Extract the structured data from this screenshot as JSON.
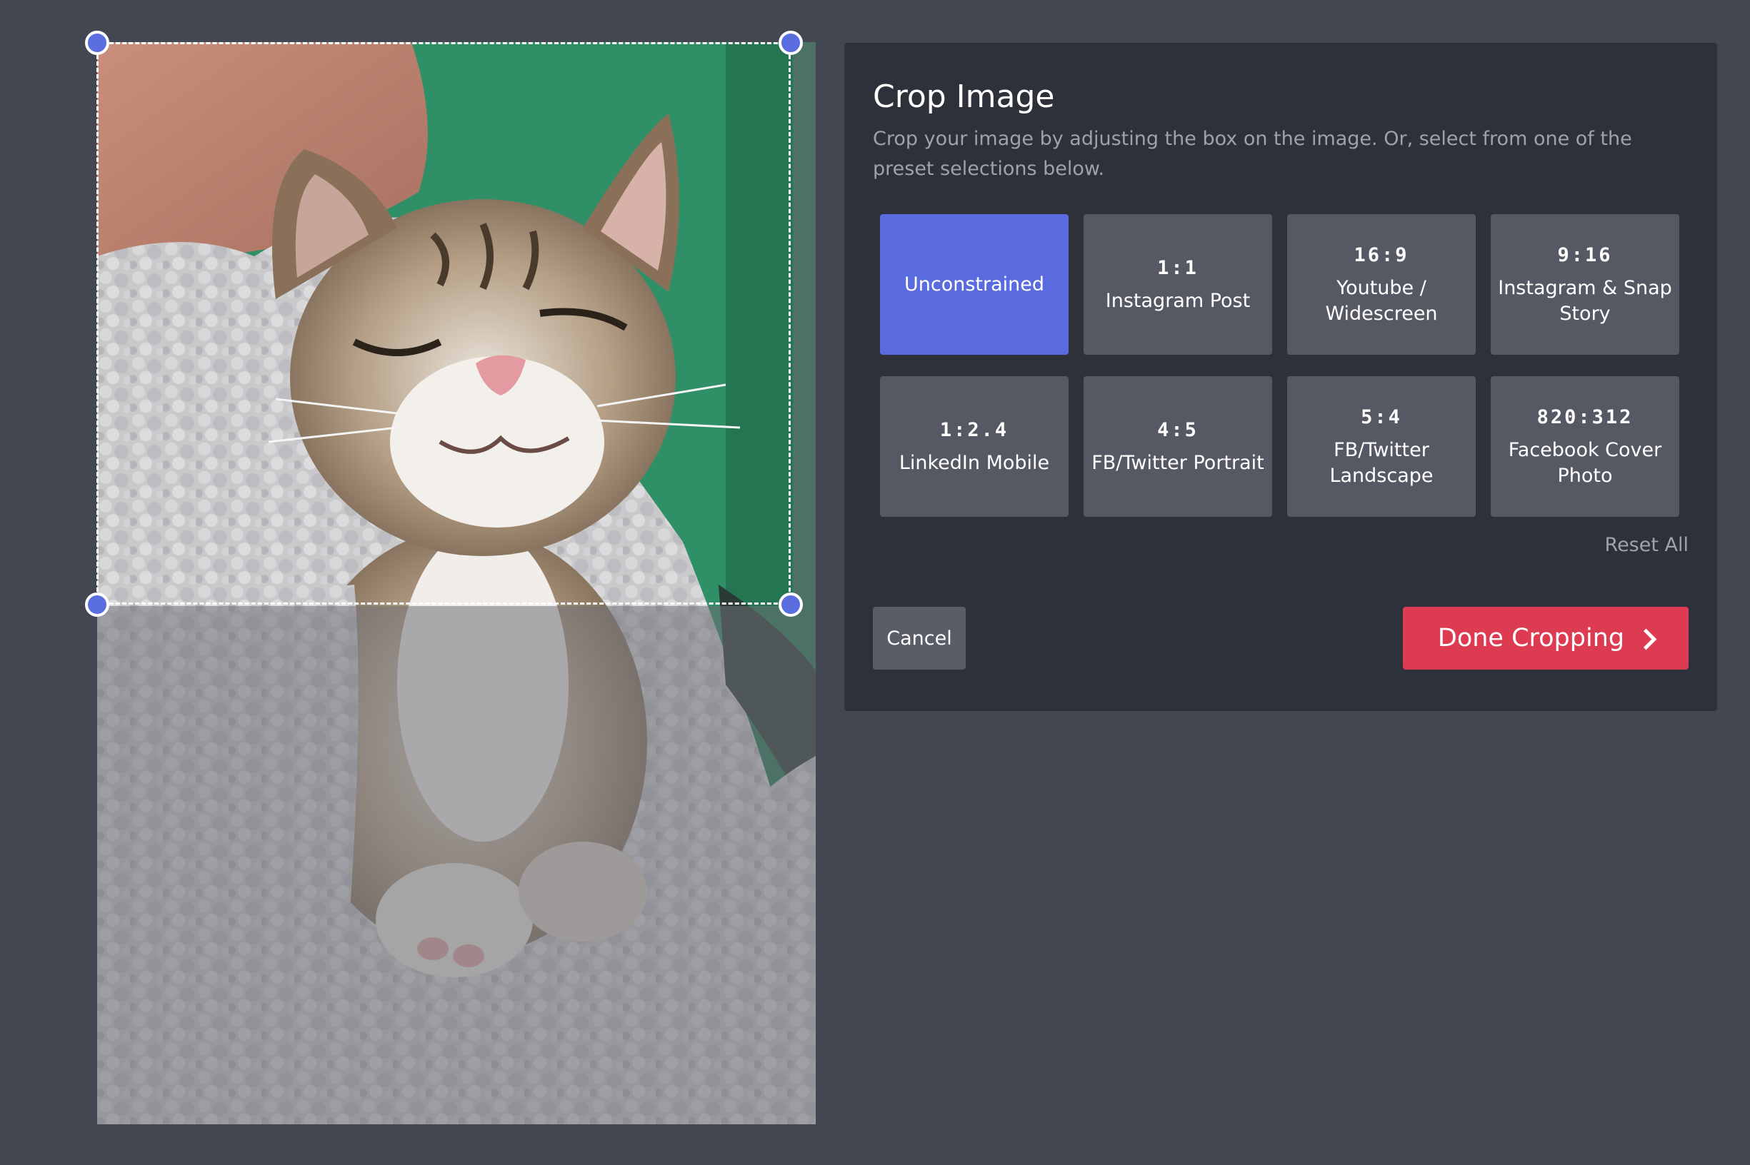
{
  "image": {
    "alt": "Photo of a sleeping kitten wrapped in a fleece blanket",
    "colors": {
      "background": "#434752",
      "panel": "#2e303a",
      "accent": "#5a6be0",
      "danger": "#dc3b52",
      "preset": "#565963"
    }
  },
  "panel": {
    "title": "Crop Image",
    "description": "Crop your image by adjusting the box on the image. Or, select from one of the preset selections below.",
    "presets": [
      {
        "ratio": "",
        "label": "Unconstrained",
        "selected": true
      },
      {
        "ratio": "1:1",
        "label": "Instagram Post",
        "selected": false
      },
      {
        "ratio": "16:9",
        "label": "Youtube / Widescreen",
        "selected": false
      },
      {
        "ratio": "9:16",
        "label": "Instagram & Snap Story",
        "selected": false
      },
      {
        "ratio": "1:2.4",
        "label": "LinkedIn Mobile",
        "selected": false
      },
      {
        "ratio": "4:5",
        "label": "FB/Twitter Portrait",
        "selected": false
      },
      {
        "ratio": "5:4",
        "label": "FB/Twitter Landscape",
        "selected": false
      },
      {
        "ratio": "820:312",
        "label": "Facebook Cover Photo",
        "selected": false
      }
    ],
    "reset_label": "Reset All",
    "cancel_label": "Cancel",
    "done_label": "Done Cropping",
    "done_icon": "chevron-right-icon"
  }
}
